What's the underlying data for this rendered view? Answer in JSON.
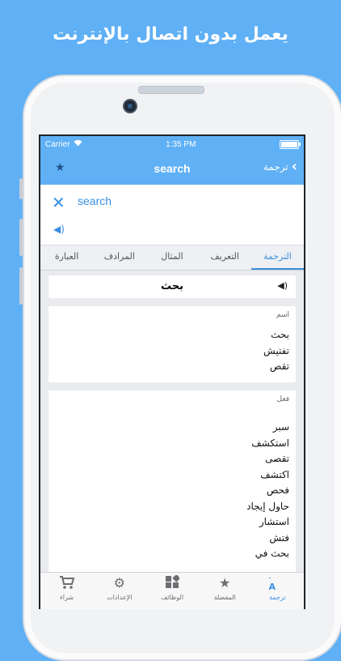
{
  "headline": "يعمل بدون اتصال بالإنترنت",
  "status_bar": {
    "carrier": "Carrier",
    "time": "1:35 PM"
  },
  "nav": {
    "title": "search",
    "back_label": "ترجمة"
  },
  "input": {
    "query": "search"
  },
  "tabs": [
    {
      "label": "الترجمة",
      "active": true
    },
    {
      "label": "التعريف",
      "active": false
    },
    {
      "label": "المثال",
      "active": false
    },
    {
      "label": "المرادف",
      "active": false
    },
    {
      "label": "العبارة",
      "active": false
    }
  ],
  "main_word": "بحث",
  "senses": [
    {
      "pos": "اسم",
      "items": [
        "بحث",
        "تفتيش",
        "تقص"
      ]
    },
    {
      "pos": "فعل",
      "items": [
        "سبر",
        "استكشف",
        "تقصى",
        "اكتشف",
        "فحص",
        "حاول إيجاد",
        "استشار",
        "فتش",
        "بحث في"
      ]
    }
  ],
  "tabbar": [
    {
      "label": "ترجمة",
      "icon": "translate-icon",
      "active": true
    },
    {
      "label": "المفضلة",
      "icon": "star-icon",
      "active": false
    },
    {
      "label": "الوظائف",
      "icon": "widgets-icon",
      "active": false
    },
    {
      "label": "الإعدادات",
      "icon": "gear-icon",
      "active": false
    },
    {
      "label": "شراء",
      "icon": "cart-icon",
      "active": false
    }
  ],
  "colors": {
    "brand_blue": "#5fb0f5",
    "accent_blue": "#3a8fe0"
  }
}
